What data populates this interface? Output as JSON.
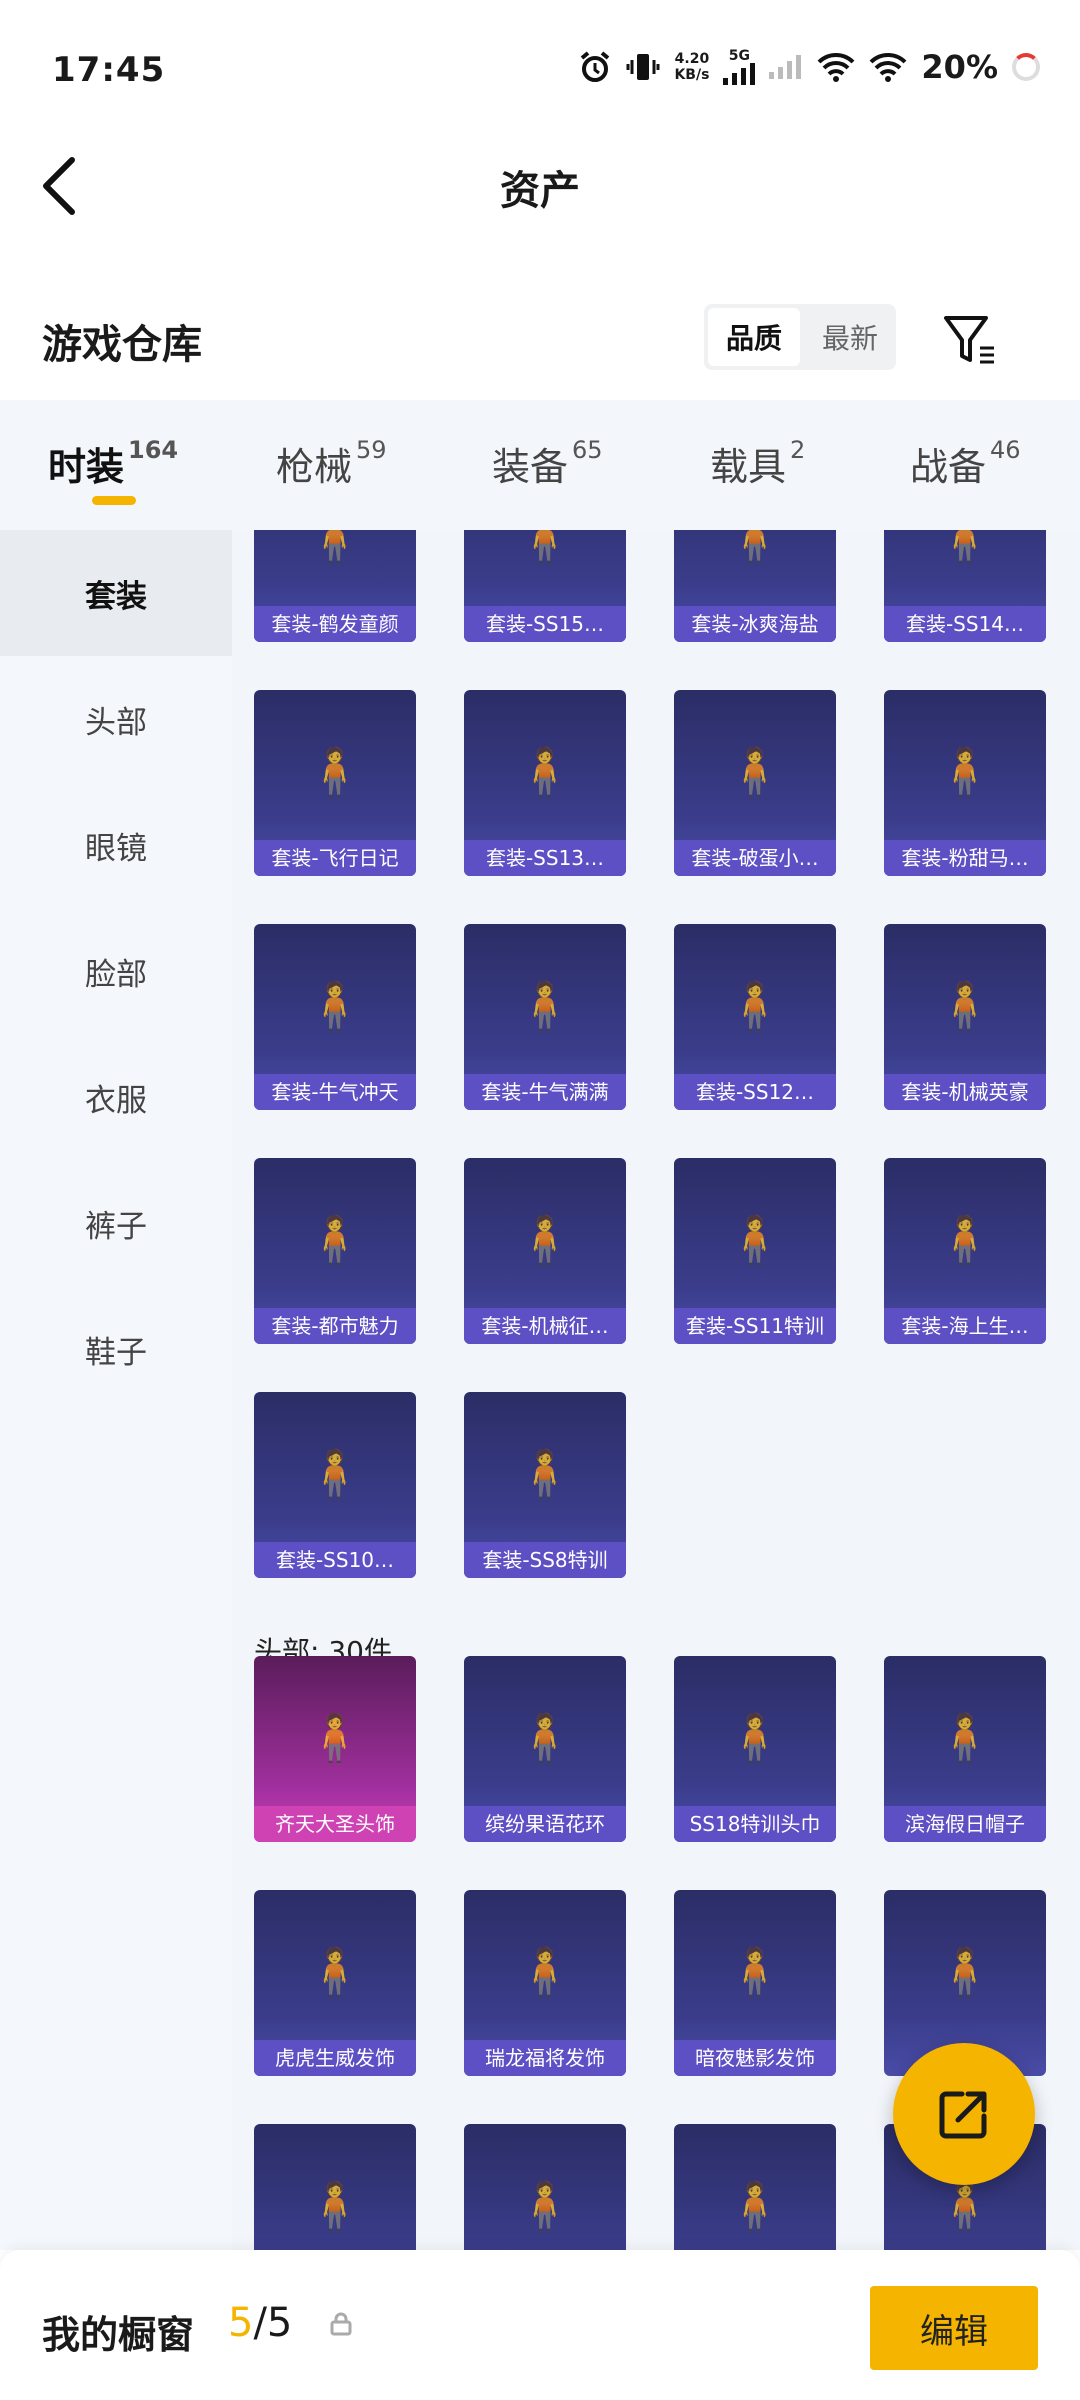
{
  "status_bar": {
    "time": "17:45",
    "net_speed_value": "4.20",
    "net_speed_unit": "KB/s",
    "network": "5G",
    "battery": "20%"
  },
  "header": {
    "title": "资产"
  },
  "warehouse": {
    "title": "游戏仓库",
    "sort_options": [
      "品质",
      "最新"
    ],
    "active_sort": "品质"
  },
  "tabs": [
    {
      "label": "时装",
      "count": "164",
      "active": true
    },
    {
      "label": "枪械",
      "count": "59",
      "active": false
    },
    {
      "label": "装备",
      "count": "65",
      "active": false
    },
    {
      "label": "载具",
      "count": "2",
      "active": false
    },
    {
      "label": "战备",
      "count": "46",
      "active": false
    }
  ],
  "sidebar": [
    "套装",
    "头部",
    "眼镜",
    "脸部",
    "衣服",
    "裤子",
    "鞋子"
  ],
  "sidebar_active": "套装",
  "suits": [
    "套装-鹤发童颜",
    "套装-SS15…",
    "套装-冰爽海盐",
    "套装-SS14…",
    "套装-飞行日记",
    "套装-SS13…",
    "套装-破蛋小…",
    "套装-粉甜马…",
    "套装-牛气冲天",
    "套装-牛气满满",
    "套装-SS12…",
    "套装-机械英豪",
    "套装-都市魅力",
    "套装-机械征…",
    "套装-SS11特训",
    "套装-海上生…",
    "套装-SS10…",
    "套装-SS8特训"
  ],
  "head_section_title": "头部: 30件",
  "head_items": [
    "齐天大圣头饰",
    "缤纷果语花环",
    "SS18特训头巾",
    "滨海假日帽子",
    "虎虎生威发饰",
    "瑞龙福将发饰",
    "暗夜魅影发饰",
    "",
    "",
    "",
    "",
    ""
  ],
  "bottom": {
    "label": "我的橱窗",
    "current": "5",
    "total": "/5",
    "edit": "编辑"
  },
  "colors": {
    "accent": "#f5b400",
    "card_label": "#5d4fc4",
    "card_label_legend": "#cf42b4"
  }
}
